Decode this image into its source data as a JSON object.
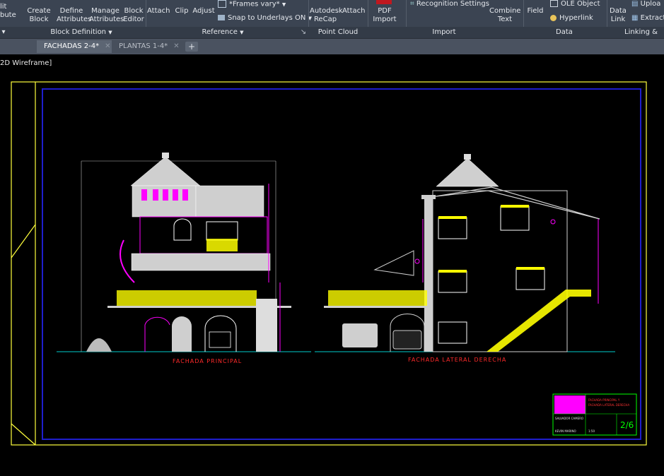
{
  "ribbon": {
    "buttons": {
      "edit_attribute": "lit\nbute",
      "create_block": "Create\nBlock",
      "define_attributes": "Define\nAttributes",
      "manage_attributes": "Manage\nAttributes",
      "block_editor": "Block\nEditor",
      "attach": "Attach",
      "clip": "Clip",
      "adjust": "Adjust",
      "frames_vary": "*Frames vary*",
      "snap_underlays": "Snap to Underlays ON",
      "autodesk_recap": "Autodesk\nReCap",
      "attach_pc": "Attach",
      "pdf_import": "PDF\nImport",
      "recognition_settings": "Recognition Settings",
      "combine_text": "Combine\nText",
      "field": "Field",
      "ole_object": "OLE Object",
      "hyperlink": "Hyperlink",
      "data_link": "Data\nLink",
      "upload": "Uploa",
      "extract": "Extract"
    },
    "panels": {
      "block_definition": "Block Definition",
      "reference": "Reference",
      "point_cloud": "Point Cloud",
      "import": "Import",
      "data": "Data",
      "linking": "Linking &"
    }
  },
  "tabs": [
    {
      "label": "FACHADAS 2-4*",
      "active": true
    },
    {
      "label": "PLANTAS 1-4*",
      "active": false
    }
  ],
  "viewport": {
    "label": "2D Wireframe]"
  },
  "drawing": {
    "left_title": "FACHADA PRINCIPAL",
    "right_title": "FACHADA LATERAL DERECHA",
    "stamp": {
      "title_line1": "FACHADA PRINCIPAL Y",
      "title_line2": "FACHADA LATERAL DERECHA",
      "sheet": "2/6",
      "author": "SALVADOR CAMERO",
      "name": "KEVIN MARINO",
      "scale": "1:50"
    },
    "colors": {
      "frame": "#ffff3c",
      "border": "#1e1ecc",
      "walls": "#d8d8d8",
      "accent": "#ff00ff",
      "railing": "#ffff00",
      "dimension": "#ff2a2a"
    }
  }
}
